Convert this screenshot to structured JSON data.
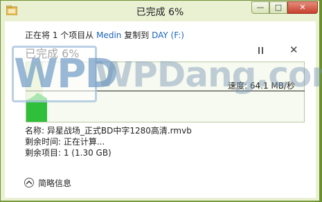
{
  "window": {
    "title": "已完成 6%",
    "controls": {
      "minimize": "—",
      "maximize": "□",
      "close": "✕"
    },
    "bar_color": "#7ea53a"
  },
  "dialog": {
    "copy_prefix": "正在将 1 个项目从",
    "source": "Medin",
    "copy_middle": "复制到",
    "destination": "DAY (F:)",
    "status": "已完成 6%",
    "progress_fraction": 0.06,
    "speed_label": "速度: 64.1 MB/秒",
    "name_line": "名称: 异星战场_正式BD中字1280高清.rmvb",
    "time_line": "剩余时间: 正在计算...",
    "items_line": "剩余项目: 1 (1.30 GB)",
    "less_details": "简略信息",
    "accent": "#1a64b8",
    "graph_color": "#2fbf3a"
  },
  "watermark": {
    "logo": "WPD",
    "text": "WPDang.com"
  }
}
